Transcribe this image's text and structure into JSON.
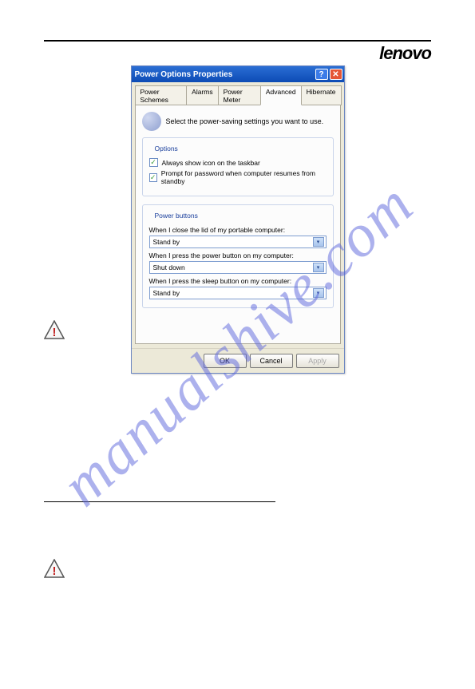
{
  "header": {
    "logo": "lenovo"
  },
  "dialog": {
    "title": "Power Options Properties",
    "help_btn": "?",
    "close_btn": "✕",
    "tabs": [
      "Power Schemes",
      "Alarms",
      "Power Meter",
      "Advanced",
      "Hibernate"
    ],
    "active_tab": 3,
    "intro": "Select the power-saving settings you want to use.",
    "options_legend": "Options",
    "chk_taskbar": "Always show icon on the taskbar",
    "chk_password": "Prompt for password when computer resumes from standby",
    "pb_legend": "Power buttons",
    "pb_lid_label": "When I close the lid of my portable computer:",
    "pb_lid_value": "Stand by",
    "pb_power_label": "When I press the power button on my computer:",
    "pb_power_value": "Shut down",
    "pb_sleep_label": "When I press the sleep button on my computer:",
    "pb_sleep_value": "Stand by",
    "ok": "OK",
    "cancel": "Cancel",
    "apply": "Apply"
  },
  "watermark": "manualshive.com"
}
